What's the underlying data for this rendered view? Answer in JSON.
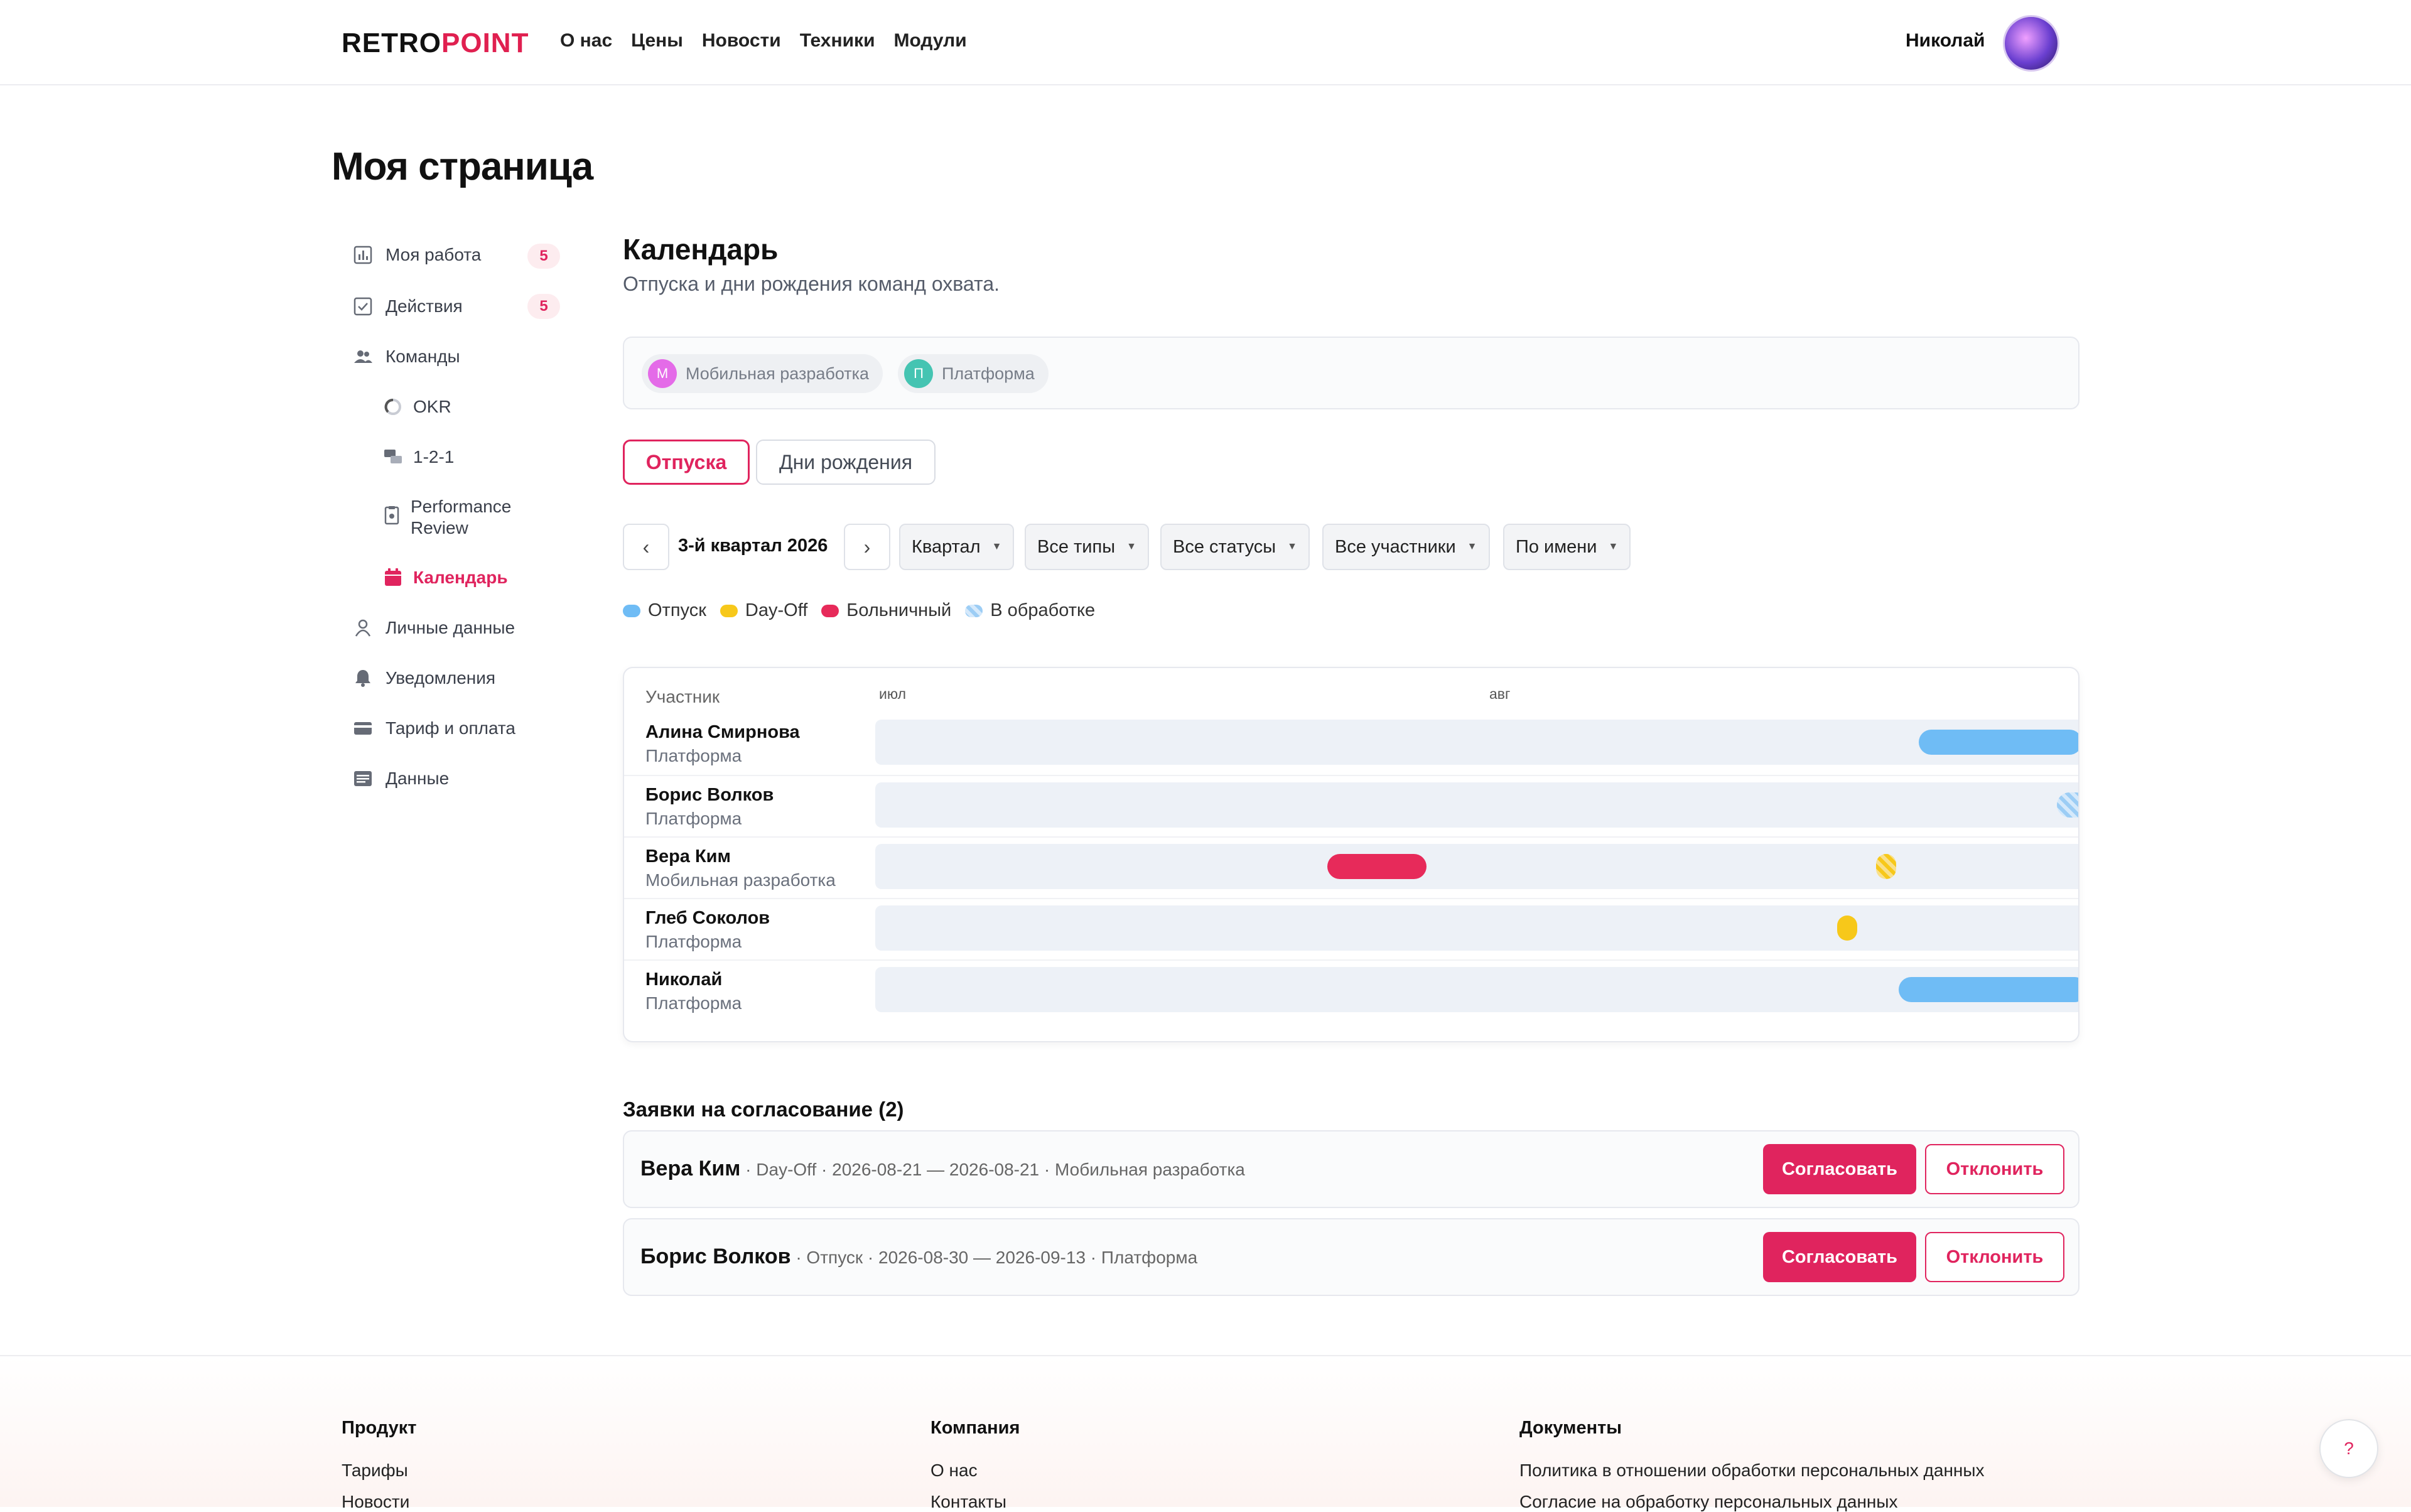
{
  "header": {
    "logo_a": "RETRO",
    "logo_b": "POINT",
    "nav": [
      "О нас",
      "Цены",
      "Новости",
      "Техники",
      "Модули"
    ],
    "user_name": "Николай"
  },
  "page_title": "Моя страница",
  "sidebar": {
    "items": [
      {
        "label": "Моя работа",
        "icon": "bar-chart-icon",
        "badge": "5"
      },
      {
        "label": "Действия",
        "icon": "checkbox-icon",
        "badge": "5"
      },
      {
        "label": "Команды",
        "icon": "users-icon"
      },
      {
        "label": "OKR",
        "icon": "progress-ring-icon"
      },
      {
        "label": "1-2-1",
        "icon": "chat-icon"
      },
      {
        "label": "Performance Review",
        "icon": "clipboard-icon"
      },
      {
        "label": "Календарь",
        "icon": "calendar-icon",
        "active": true
      },
      {
        "label": "Личные данные",
        "icon": "person-icon"
      },
      {
        "label": "Уведомления",
        "icon": "bell-icon"
      },
      {
        "label": "Тариф и оплата",
        "icon": "card-icon"
      },
      {
        "label": "Данные",
        "icon": "table-icon"
      }
    ]
  },
  "calendar": {
    "title": "Календарь",
    "subtitle": "Отпуска и дни рождения команд охвата.",
    "teams": [
      {
        "initial": "М",
        "name": "Мобильная разработка",
        "color": "#e46be8"
      },
      {
        "initial": "П",
        "name": "Платформа",
        "color": "#45c4b2"
      }
    ],
    "tabs": [
      "Отпуска",
      "Дни рождения"
    ],
    "period": "3-й квартал 2026",
    "filters": [
      "Квартал",
      "Все типы",
      "Все статусы",
      "Все участники",
      "По имени"
    ],
    "legend": [
      {
        "label": "Отпуск",
        "color": "#6fbcf5"
      },
      {
        "label": "Day-Off",
        "color": "#f7c81a"
      },
      {
        "label": "Больничный",
        "color": "#e72a5a"
      },
      {
        "label": "В обработке",
        "color": "#9ccdf5"
      }
    ],
    "column_header": "Участник",
    "months": [
      "июл",
      "авг"
    ],
    "rows": [
      {
        "name": "Алина Смирнова",
        "team": "Платформа"
      },
      {
        "name": "Борис Волков",
        "team": "Платформа"
      },
      {
        "name": "Вера Ким",
        "team": "Мобильная разработка"
      },
      {
        "name": "Глеб Соколов",
        "team": "Платформа"
      },
      {
        "name": "Николай",
        "team": "Платформа"
      }
    ]
  },
  "requests": {
    "title": "Заявки на согласование (2)",
    "items": [
      {
        "name": "Вера Ким",
        "details": " · Day-Off · 2026-08-21 — 2026-08-21 · Мобильная разработка"
      },
      {
        "name": "Борис Волков",
        "details": " · Отпуск · 2026-08-30 — 2026-09-13 · Платформа"
      }
    ],
    "approve": "Согласовать",
    "reject": "Отклонить"
  },
  "footer": {
    "cols": [
      {
        "title": "Продукт",
        "links": [
          "Тарифы",
          "Новости"
        ]
      },
      {
        "title": "Компания",
        "links": [
          "О нас",
          "Контакты"
        ]
      },
      {
        "title": "Документы",
        "links": [
          "Политика в отношении обработки персональных данных",
          "Согласие на обработку персональных данных"
        ]
      }
    ],
    "help": "?"
  }
}
